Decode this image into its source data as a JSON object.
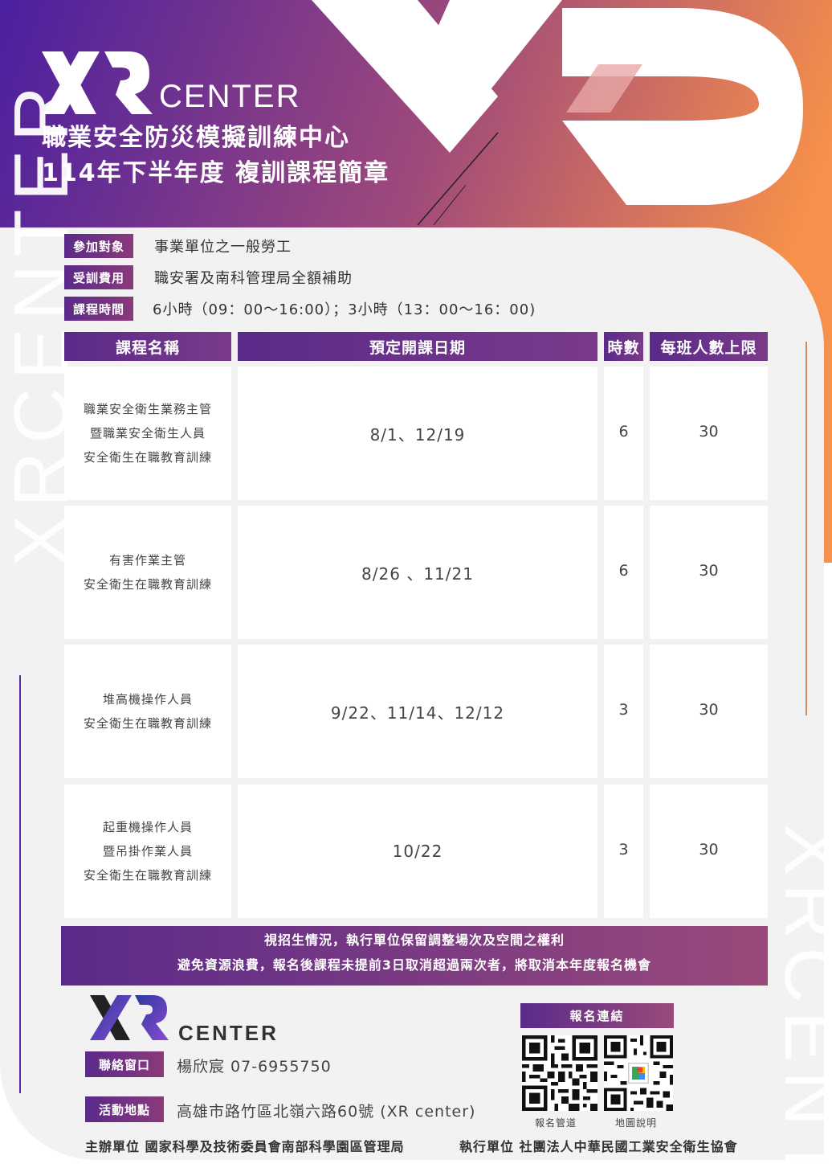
{
  "header": {
    "logo_text": "CENTER",
    "title_line1": "職業安全防災模擬訓練中心",
    "title_line2": "114年下半年度  複訓課程簡章"
  },
  "watermark": {
    "left": "XRCENTER",
    "right": "XRCENTER"
  },
  "info": [
    {
      "label": "參加對象",
      "value": "事業單位之一般勞工"
    },
    {
      "label": "受訓費用",
      "value": "職安署及南科管理局全額補助"
    },
    {
      "label": "課程時間",
      "value": "6小時（09：00～16:00）；3小時（13：00～16：00)"
    }
  ],
  "table": {
    "headers": [
      "課程名稱",
      "預定開課日期",
      "時數",
      "每班人數上限"
    ],
    "rows": [
      {
        "name": [
          "職業安全衛生業務主管",
          "暨職業安全衛生人員",
          "安全衛生在職教育訓練"
        ],
        "dates": "8/1、12/19",
        "hours": "6",
        "capacity": "30"
      },
      {
        "name": [
          "有害作業主管",
          "安全衛生在職教育訓練"
        ],
        "dates": "8/26 、11/21",
        "hours": "6",
        "capacity": "30"
      },
      {
        "name": [
          "堆高機操作人員",
          "安全衛生在職教育訓練"
        ],
        "dates": "9/22、11/14、12/12",
        "hours": "3",
        "capacity": "30"
      },
      {
        "name": [
          "起重機操作人員",
          "暨吊掛作業人員",
          "安全衛生在職教育訓練"
        ],
        "dates": "10/22",
        "hours": "3",
        "capacity": "30"
      }
    ]
  },
  "notice": [
    "視招生情況，執行單位保留調整場次及空間之權利",
    "避免資源浪費，報名後課程未提前3日取消超過兩次者，將取消本年度報名機會"
  ],
  "footer": {
    "logo_text": "CENTER",
    "contact_label": "聯絡窗口",
    "contact_value": "楊欣宸 07-6955750",
    "location_label": "活動地點",
    "location_value": "高雄市路竹區北嶺六路60號 (XR center)",
    "register_label": "報名連結",
    "qr_captions": [
      "報名管道",
      "地圖說明"
    ],
    "organizer": "主辦單位  國家科學及技術委員會南部科學園區管理局",
    "executor": "執行單位  社團法人中華民國工業安全衛生協會"
  },
  "colors": {
    "purple": "#4a1fa0",
    "magenta": "#a04a7a",
    "orange": "#f28a4a",
    "card": "#f2f2f2"
  }
}
